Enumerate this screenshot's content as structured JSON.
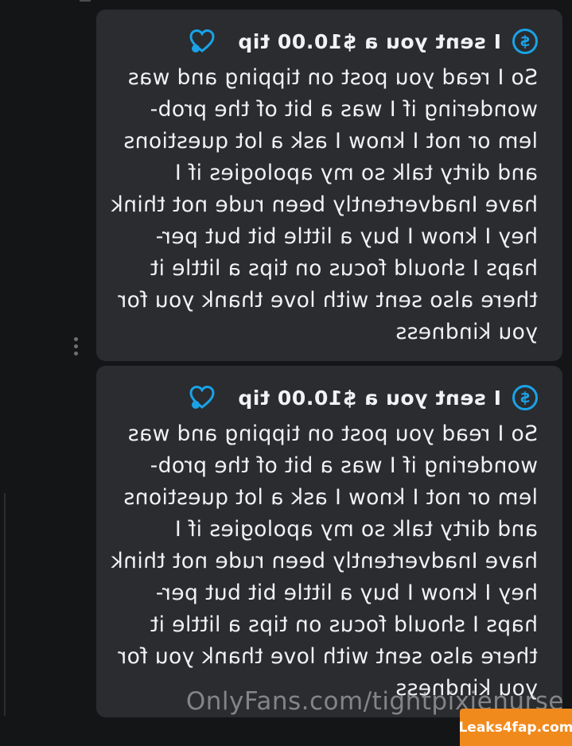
{
  "messages": [
    {
      "tip_title": "I sent you a $10.00 tip",
      "lines": [
        "So I read you post on tipping and was",
        "wondering if I was a bit of the prob-",
        "lem or not I know I ask a lot questions",
        "and dirty talk so my apologies if I",
        "have Inadvertently been rude not think",
        "hey I know I buy a little bit but per-",
        "haps I should focus on tips a little it",
        "there also sent with love thank you for",
        "you kindness"
      ]
    },
    {
      "tip_title": "I sent you a $10.00 tip",
      "lines": [
        "So I read you post on tipping and was",
        "wondering if I was a bit of the prob-",
        "lem or not I know I ask a lot questions",
        "and dirty talk so my apologies if I",
        "have Inadvertently been rude not think",
        "hey I know I buy a little bit but per-",
        "haps I should focus on tips a little it",
        "there also sent with love thank you for",
        "you kindness"
      ]
    }
  ],
  "icons": {
    "tip": "dollar-circle-icon",
    "like": "heart-icon",
    "menu": "more-vertical-icon"
  },
  "colors": {
    "accent": "#1aa3e6",
    "bubble": "#2a2c30",
    "background": "#141517",
    "badge": "#f18a1c"
  },
  "watermark": {
    "text": "OnlyFans.com/tightpixienurse"
  },
  "badge": {
    "text": "Leaks4fap.com"
  }
}
